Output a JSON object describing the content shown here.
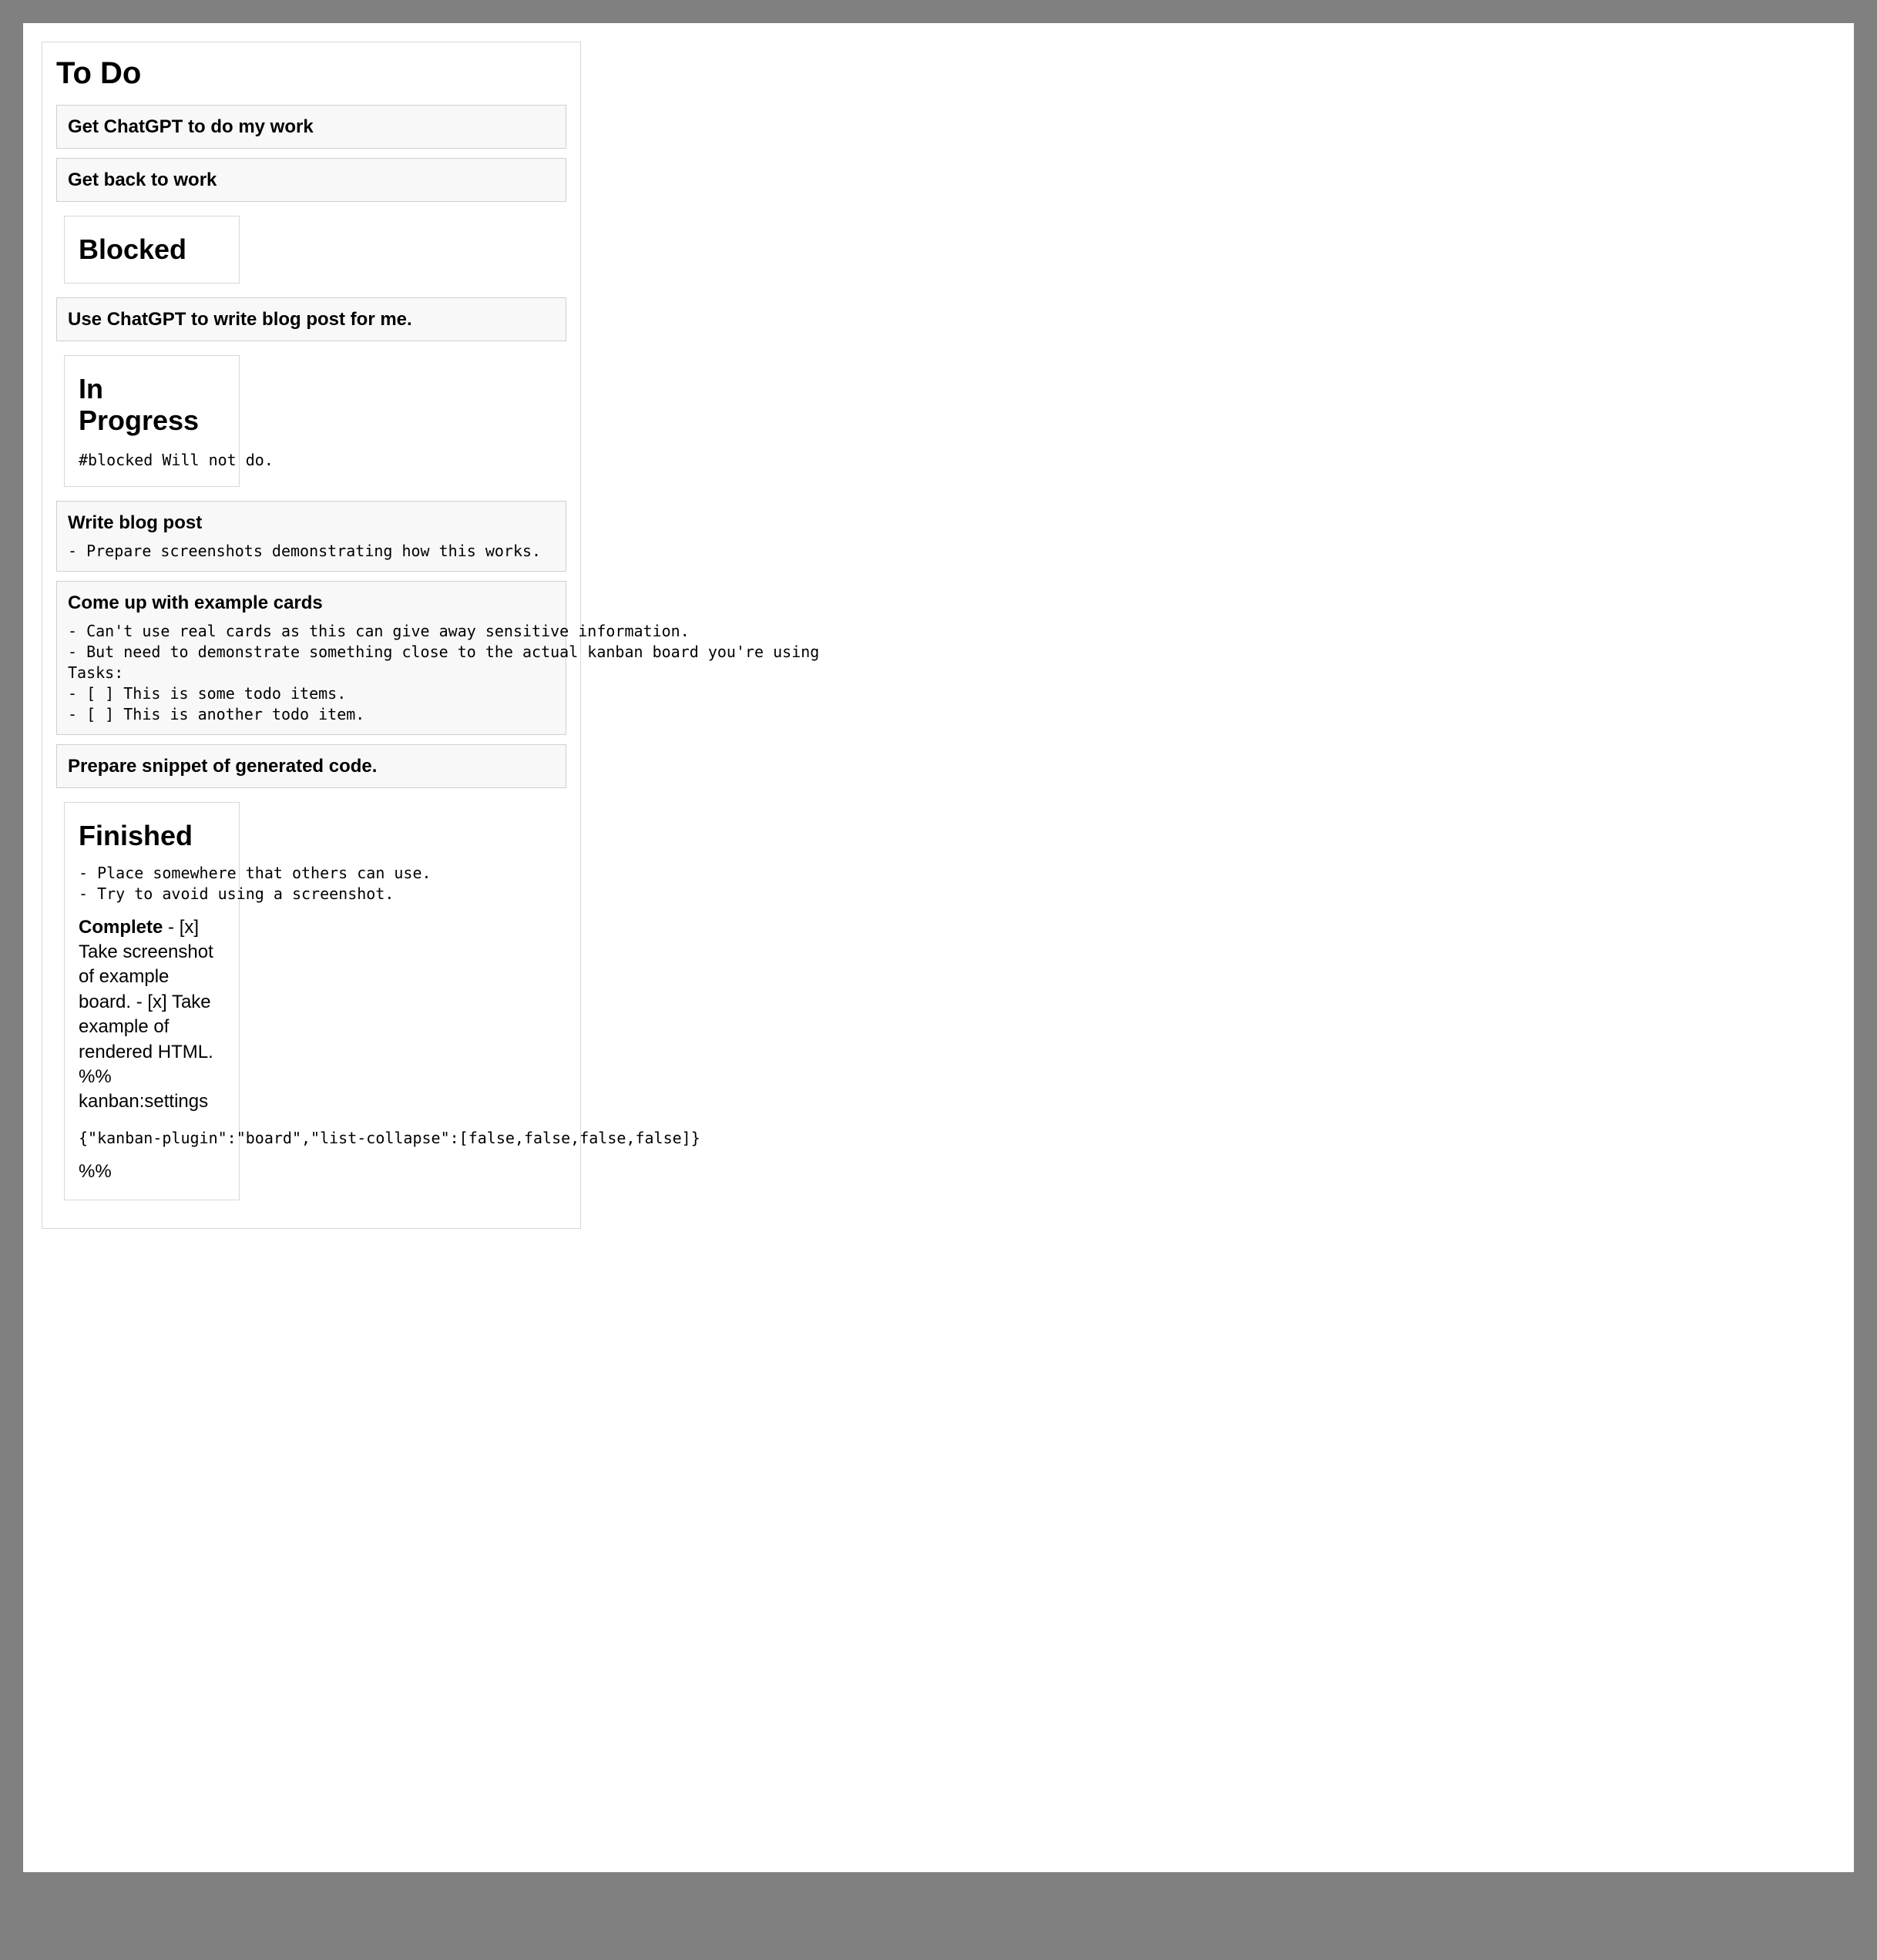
{
  "column": {
    "title": "To Do",
    "cards": [
      {
        "title": "Get ChatGPT to do my work"
      },
      {
        "title": "Get back to work"
      }
    ]
  },
  "blocked": {
    "title": "Blocked",
    "card": {
      "title": "Use ChatGPT to write blog post for me."
    }
  },
  "inprogress": {
    "title": "In Progress",
    "note": "#blocked Will not do.",
    "cards": [
      {
        "title": "Write blog post",
        "body": "- Prepare screenshots demonstrating how this works."
      },
      {
        "title": "Come up with example cards",
        "body": "- Can't use real cards as this can give away sensitive information.\n- But need to demonstrate something close to the actual kanban board you're using\nTasks:\n- [ ] This is some todo items.\n- [ ] This is another todo item."
      },
      {
        "title": "Prepare snippet of generated code."
      }
    ]
  },
  "finished": {
    "title": "Finished",
    "body": "- Place somewhere that others can use.\n- Try to avoid using a screenshot.",
    "complete_label": "Complete",
    "complete_text": " - [x] Take screenshot of example board. - [x] Take example of rendered HTML. %% kanban:settings",
    "json": "{\"kanban-plugin\":\"board\",\"list-collapse\":[false,false,false,false]}",
    "pct": "%%"
  }
}
